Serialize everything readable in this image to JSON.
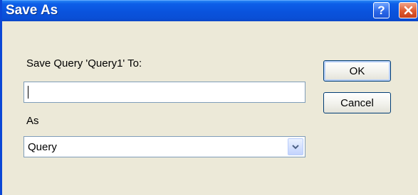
{
  "window": {
    "title": "Save As",
    "help_label": "?",
    "close_label": "X"
  },
  "form": {
    "save_label": "Save Query 'Query1' To:",
    "name_value": "",
    "as_label": "As",
    "as_selected": "Query"
  },
  "buttons": {
    "ok_label": "OK",
    "cancel_label": "Cancel"
  },
  "colors": {
    "titlebar": "#0a53dd",
    "dialog_bg": "#ece9d8",
    "close_button": "#df5a2e",
    "input_border": "#7f9db9",
    "button_border": "#003c74"
  },
  "icons": {
    "help": "help-icon",
    "close": "close-icon",
    "dropdown": "chevron-down-icon"
  }
}
